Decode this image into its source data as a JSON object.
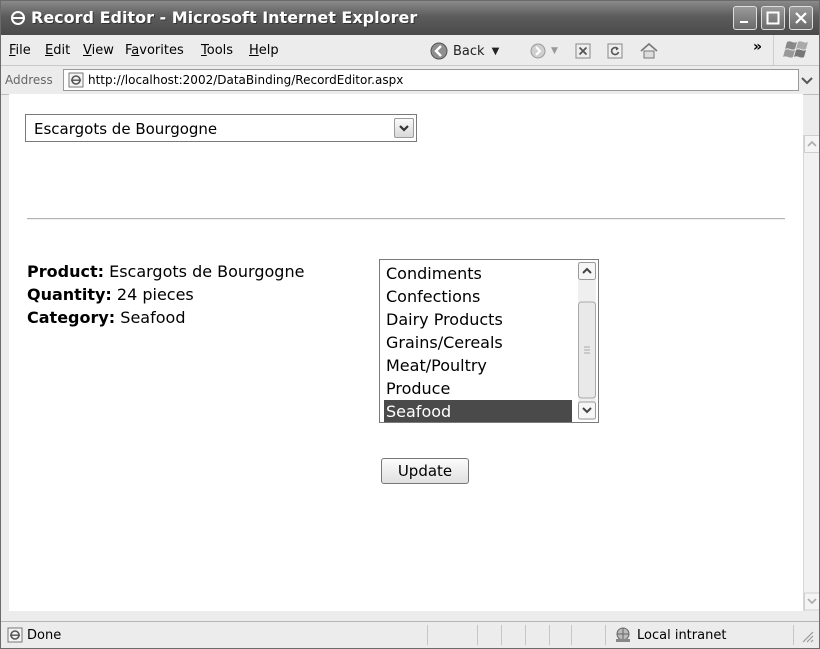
{
  "window": {
    "title": "Record Editor - Microsoft Internet Explorer"
  },
  "menu": {
    "items": [
      {
        "label": "File",
        "accel_index": 0
      },
      {
        "label": "Edit",
        "accel_index": 0
      },
      {
        "label": "View",
        "accel_index": 0
      },
      {
        "label": "Favorites",
        "accel_index": 1
      },
      {
        "label": "Tools",
        "accel_index": 0
      },
      {
        "label": "Help",
        "accel_index": 0
      }
    ],
    "back_label": "Back",
    "overflow": "»"
  },
  "address": {
    "label": "Address",
    "url": "http://localhost:2002/DataBinding/RecordEditor.aspx"
  },
  "page": {
    "product_select": {
      "selected": "Escargots de Bourgogne"
    },
    "details": {
      "product_label": "Product:",
      "product_value": "Escargots de Bourgogne",
      "quantity_label": "Quantity:",
      "quantity_value": "24 pieces",
      "category_label": "Category:",
      "category_value": "Seafood"
    },
    "category_list": {
      "items": [
        "Condiments",
        "Confections",
        "Dairy Products",
        "Grains/Cereals",
        "Meat/Poultry",
        "Produce",
        "Seafood"
      ],
      "selected": "Seafood"
    },
    "update_label": "Update"
  },
  "status": {
    "text": "Done",
    "zone": "Local intranet"
  },
  "colors": {
    "title_bar": "#5c5c5c",
    "selection": "#4a4a4a",
    "chrome": "#ececec"
  }
}
